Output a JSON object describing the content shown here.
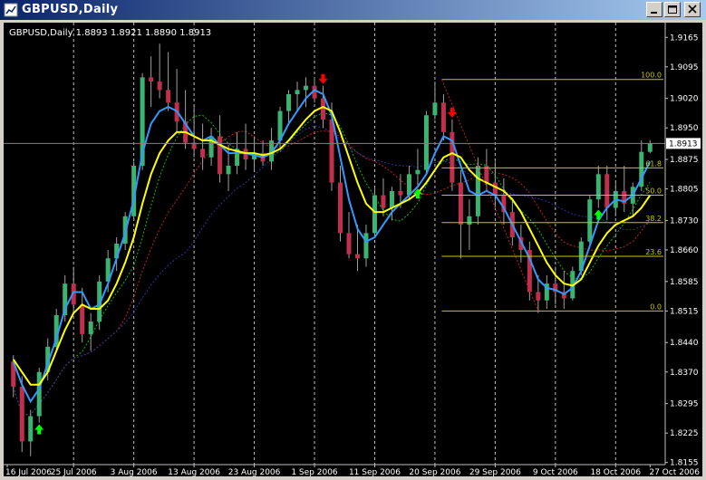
{
  "window": {
    "title": "GBPUSD,Daily",
    "buttons": [
      "minimize",
      "maximize",
      "close"
    ]
  },
  "chart_info": "GBPUSD,Daily  1.8893 1.8921 1.8890 1.8913",
  "colors": {
    "background": "#000000",
    "axis": "#c0c0c0",
    "bull": "#3cb371",
    "bear": "#c0304d",
    "ma_fast": "#3399ff",
    "ma_slow": "#ffff00",
    "ma_green": "#00c000",
    "ma_red": "#c02020",
    "ma_blue": "#3030a0",
    "fib": "#c8c800",
    "current_price_line": "#808080"
  },
  "chart_data": {
    "type": "candlestick",
    "symbol": "GBPUSD",
    "timeframe": "Daily",
    "last_ohlc": {
      "open": 1.8893,
      "high": 1.8921,
      "low": 1.889,
      "close": 1.8913
    },
    "current_price": "1.8913",
    "ylim": [
      1.815,
      1.92
    ],
    "y_ticks": [
      "1.9165",
      "1.9095",
      "1.9020",
      "1.8950",
      "1.8875",
      "1.8805",
      "1.8730",
      "1.8660",
      "1.8585",
      "1.8515",
      "1.8440",
      "1.8370",
      "1.8295",
      "1.8225",
      "1.8155"
    ],
    "x_ticks": [
      "16 Jul 2006",
      "25 Jul 2006",
      "3 Aug 2006",
      "13 Aug 2006",
      "23 Aug 2006",
      "1 Sep 2006",
      "11 Sep 2006",
      "20 Sep 2006",
      "29 Sep 2006",
      "9 Oct 2006",
      "18 Oct 2006",
      "27 Oct 2006"
    ],
    "candles": [
      [
        1.8395,
        1.841,
        1.831,
        1.8335
      ],
      [
        1.8335,
        1.836,
        1.818,
        1.8205
      ],
      [
        1.8205,
        1.828,
        1.817,
        1.8265
      ],
      [
        1.8265,
        1.838,
        1.825,
        1.837
      ],
      [
        1.837,
        1.845,
        1.835,
        1.843
      ],
      [
        1.843,
        1.852,
        1.842,
        1.8505
      ],
      [
        1.8505,
        1.86,
        1.849,
        1.858
      ],
      [
        1.858,
        1.862,
        1.851,
        1.853
      ],
      [
        1.853,
        1.857,
        1.844,
        1.846
      ],
      [
        1.846,
        1.851,
        1.842,
        1.849
      ],
      [
        1.849,
        1.86,
        1.847,
        1.8585
      ],
      [
        1.8585,
        1.866,
        1.856,
        1.864
      ],
      [
        1.864,
        1.869,
        1.861,
        1.8675
      ],
      [
        1.8675,
        1.875,
        1.866,
        1.874
      ],
      [
        1.874,
        1.887,
        1.873,
        1.886
      ],
      [
        1.886,
        1.908,
        1.885,
        1.907
      ],
      [
        1.907,
        1.912,
        1.9,
        1.906
      ],
      [
        1.906,
        1.915,
        1.902,
        1.904
      ],
      [
        1.904,
        1.913,
        1.899,
        1.901
      ],
      [
        1.901,
        1.909,
        1.894,
        1.8965
      ],
      [
        1.8965,
        1.904,
        1.89,
        1.8915
      ],
      [
        1.8915,
        1.9,
        1.888,
        1.89
      ],
      [
        1.89,
        1.896,
        1.885,
        1.888
      ],
      [
        1.888,
        1.895,
        1.886,
        1.893
      ],
      [
        1.893,
        1.898,
        1.882,
        1.884
      ],
      [
        1.884,
        1.891,
        1.88,
        1.886
      ],
      [
        1.886,
        1.894,
        1.884,
        1.89
      ],
      [
        1.89,
        1.896,
        1.885,
        1.8875
      ],
      [
        1.8875,
        1.893,
        1.885,
        1.889
      ],
      [
        1.889,
        1.892,
        1.886,
        1.887
      ],
      [
        1.887,
        1.895,
        1.885,
        1.892
      ],
      [
        1.892,
        1.9,
        1.89,
        1.899
      ],
      [
        1.899,
        1.904,
        1.896,
        1.903
      ],
      [
        1.903,
        1.906,
        1.899,
        1.904
      ],
      [
        1.904,
        1.907,
        1.9,
        1.905
      ],
      [
        1.905,
        1.907,
        1.901,
        1.902
      ],
      [
        1.902,
        1.905,
        1.895,
        1.897
      ],
      [
        1.897,
        1.901,
        1.88,
        1.882
      ],
      [
        1.882,
        1.886,
        1.868,
        1.87
      ],
      [
        1.87,
        1.875,
        1.864,
        1.865
      ],
      [
        1.865,
        1.872,
        1.861,
        1.864
      ],
      [
        1.864,
        1.872,
        1.862,
        1.87
      ],
      [
        1.87,
        1.881,
        1.869,
        1.879
      ],
      [
        1.879,
        1.883,
        1.874,
        1.876
      ],
      [
        1.876,
        1.881,
        1.873,
        1.88
      ],
      [
        1.88,
        1.884,
        1.876,
        1.879
      ],
      [
        1.879,
        1.886,
        1.878,
        1.884
      ],
      [
        1.884,
        1.89,
        1.881,
        1.885
      ],
      [
        1.885,
        1.899,
        1.884,
        1.898
      ],
      [
        1.898,
        1.906,
        1.897,
        1.901
      ],
      [
        1.901,
        1.903,
        1.892,
        1.894
      ],
      [
        1.894,
        1.897,
        1.88,
        1.882
      ],
      [
        1.882,
        1.885,
        1.864,
        1.872
      ],
      [
        1.872,
        1.878,
        1.866,
        1.874
      ],
      [
        1.874,
        1.888,
        1.872,
        1.886
      ],
      [
        1.886,
        1.89,
        1.88,
        1.882
      ],
      [
        1.882,
        1.887,
        1.876,
        1.879
      ],
      [
        1.879,
        1.883,
        1.872,
        1.875
      ],
      [
        1.875,
        1.878,
        1.867,
        1.869
      ],
      [
        1.869,
        1.872,
        1.863,
        1.866
      ],
      [
        1.866,
        1.868,
        1.854,
        1.856
      ],
      [
        1.856,
        1.86,
        1.851,
        1.854
      ],
      [
        1.854,
        1.86,
        1.852,
        1.858
      ],
      [
        1.858,
        1.862,
        1.853,
        1.856
      ],
      [
        1.856,
        1.861,
        1.852,
        1.8545
      ],
      [
        1.8545,
        1.862,
        1.854,
        1.861
      ],
      [
        1.861,
        1.869,
        1.86,
        1.868
      ],
      [
        1.868,
        1.879,
        1.867,
        1.878
      ],
      [
        1.878,
        1.886,
        1.876,
        1.884
      ],
      [
        1.884,
        1.886,
        1.873,
        1.876
      ],
      [
        1.876,
        1.882,
        1.874,
        1.88
      ],
      [
        1.88,
        1.886,
        1.875,
        1.877
      ],
      [
        1.877,
        1.882,
        1.874,
        1.881
      ],
      [
        1.881,
        1.892,
        1.88,
        1.8893
      ],
      [
        1.8893,
        1.8921,
        1.889,
        1.8913
      ]
    ],
    "ma_fast": [
      1.8395,
      1.834,
      1.83,
      1.833,
      1.839,
      1.845,
      1.852,
      1.856,
      1.856,
      1.852,
      1.853,
      1.858,
      1.864,
      1.87,
      1.878,
      1.889,
      1.896,
      1.899,
      1.9,
      1.899,
      1.896,
      1.893,
      1.892,
      1.893,
      1.891,
      1.889,
      1.889,
      1.889,
      1.8885,
      1.888,
      1.889,
      1.892,
      1.896,
      1.899,
      1.902,
      1.904,
      1.903,
      1.898,
      1.888,
      1.878,
      1.871,
      1.868,
      1.869,
      1.872,
      1.875,
      1.877,
      1.879,
      1.881,
      1.884,
      1.889,
      1.893,
      1.892,
      1.886,
      1.88,
      1.879,
      1.88,
      1.879,
      1.876,
      1.872,
      1.868,
      1.864,
      1.859,
      1.857,
      1.8565,
      1.8555,
      1.857,
      1.861,
      1.867,
      1.873,
      1.876,
      1.878,
      1.8775,
      1.879,
      1.883,
      1.887
    ],
    "ma_slow": [
      1.84,
      1.837,
      1.834,
      1.834,
      1.837,
      1.842,
      1.847,
      1.851,
      1.853,
      1.852,
      1.852,
      1.854,
      1.858,
      1.863,
      1.869,
      1.877,
      1.884,
      1.889,
      1.892,
      1.894,
      1.894,
      1.893,
      1.892,
      1.892,
      1.891,
      1.89,
      1.8895,
      1.889,
      1.889,
      1.8885,
      1.889,
      1.89,
      1.892,
      1.8945,
      1.897,
      1.899,
      1.9,
      1.899,
      1.894,
      1.888,
      1.882,
      1.877,
      1.875,
      1.875,
      1.876,
      1.877,
      1.878,
      1.8795,
      1.882,
      1.885,
      1.888,
      1.889,
      1.888,
      1.885,
      1.883,
      1.882,
      1.881,
      1.88,
      1.878,
      1.875,
      1.871,
      1.867,
      1.863,
      1.86,
      1.858,
      1.8575,
      1.859,
      1.863,
      1.867,
      1.87,
      1.872,
      1.873,
      1.874,
      1.876,
      1.879
    ],
    "fibonacci": {
      "levels": [
        {
          "label": "100.0",
          "price": 1.9065
        },
        {
          "label": "61.8",
          "price": 1.8855
        },
        {
          "label": "50.0",
          "price": 1.879
        },
        {
          "label": "38.2",
          "price": 1.8725
        },
        {
          "label": "23.6",
          "price": 1.8645
        },
        {
          "label": "0.0",
          "price": 1.8515
        }
      ],
      "start_index": 50
    },
    "arrows": [
      {
        "index": 3,
        "direction": "up",
        "color": "#00ff00"
      },
      {
        "index": 36,
        "direction": "down",
        "color": "#ff0000"
      },
      {
        "index": 47,
        "direction": "up",
        "color": "#00ff00"
      },
      {
        "index": 51,
        "direction": "down",
        "color": "#ff0000"
      },
      {
        "index": 68,
        "direction": "up",
        "color": "#00ff00"
      }
    ]
  }
}
